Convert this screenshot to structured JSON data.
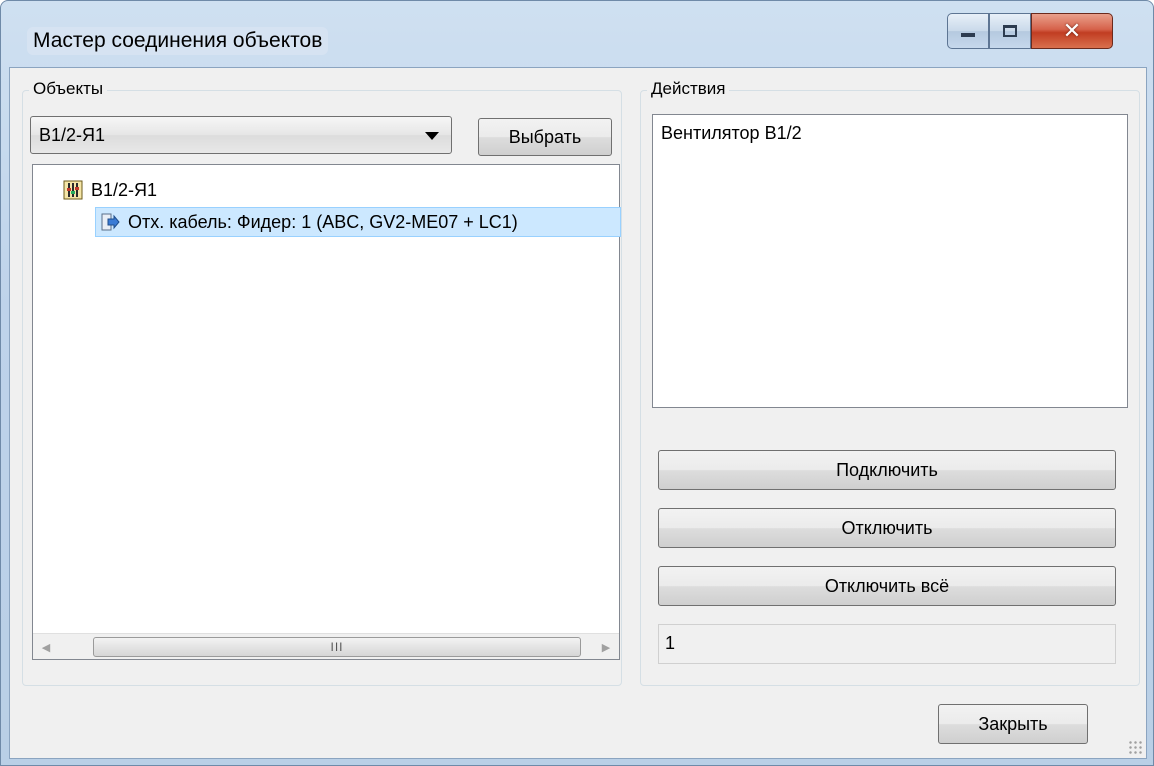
{
  "window": {
    "title": "Мастер соединения объектов",
    "controls": [
      "minimize-icon",
      "maximize-icon",
      "close-icon"
    ]
  },
  "objects_group": {
    "label": "Объекты",
    "combo_value": "В1/2-Я1",
    "select_button": "Выбрать",
    "tree": {
      "root": {
        "label": "В1/2-Я1",
        "icon": "switchboard-icon"
      },
      "children": [
        {
          "label": "Отх. кабель: Фидер: 1 (ABC, GV2-ME07 + LC1)",
          "icon": "cable-out-icon",
          "selected": true
        }
      ]
    },
    "scrollbar": {
      "thumb_grip": "III"
    }
  },
  "actions_group": {
    "label": "Действия",
    "list_items": [
      "Вентилятор В1/2"
    ],
    "connect_button": "Подключить",
    "disconnect_button": "Отключить",
    "disconnect_all_button": "Отключить всё",
    "count_field_value": "1"
  },
  "footer": {
    "close_button": "Закрыть"
  },
  "colors": {
    "selection": "#cce8ff",
    "close_control": "#c13d22",
    "titlebar": "#bed3ea"
  }
}
